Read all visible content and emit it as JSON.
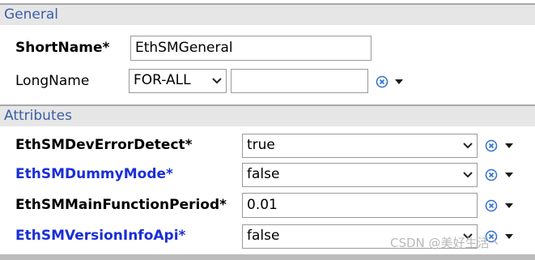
{
  "general": {
    "title": "General",
    "short_name_label": "ShortName*",
    "short_name_value": "EthSMGeneral",
    "long_name_label": "LongName",
    "long_name_lang": "FOR-ALL",
    "long_name_value": ""
  },
  "attributes": {
    "title": "Attributes",
    "rows": [
      {
        "label": "EthSMDevErrorDetect*",
        "value": "true",
        "control": "combo"
      },
      {
        "label": "EthSMDummyMode*",
        "value": "false",
        "control": "combo"
      },
      {
        "label": "EthSMMainFunctionPeriod*",
        "value": "0.01",
        "control": "text"
      },
      {
        "label": "EthSMVersionInfoApi*",
        "value": "false",
        "control": "combo"
      }
    ]
  },
  "icons": {
    "reset": "reset-default-icon",
    "menu": "dropdown-menu-icon",
    "combo_arrow": "chevron-down-icon"
  },
  "colors": {
    "section_title": "#3a5ea8",
    "link_label": "#1a2fd6",
    "icon_blue": "#2f6fd0"
  },
  "watermark": "CSDN @美好生活丶"
}
